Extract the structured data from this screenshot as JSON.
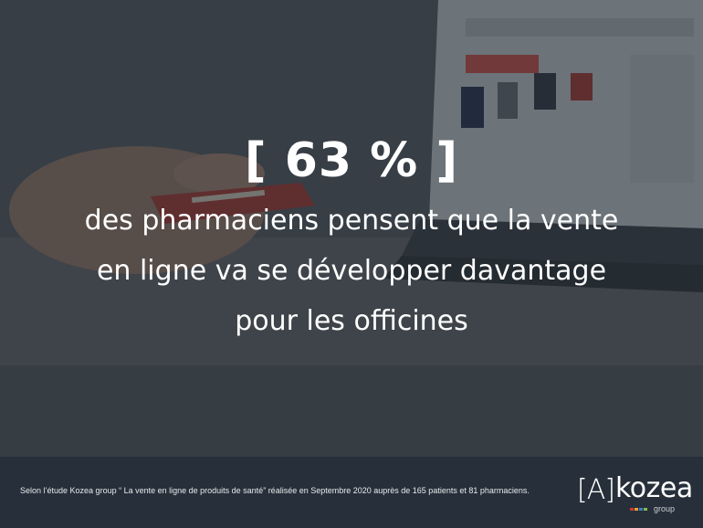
{
  "headline": {
    "stat": "[ 63 % ]",
    "statement": "des pharmaciens pensent que la vente en ligne va se développer davantage pour les officines"
  },
  "footer": {
    "source": "Selon l’étude Kozea group “ La vente en ligne de produits de santé” réalisée en Septembre 2020 auprès de 165 patients et 81 pharmaciens."
  },
  "logo": {
    "mark": "[A]",
    "word": "kozea",
    "sub": "group"
  },
  "colors": {
    "overlay": "#1c242e",
    "footer": "#27303a",
    "dots": [
      "#d13b2f",
      "#e9a23b",
      "#3f7ec6",
      "#8bb84a",
      "#9b5bb0"
    ]
  },
  "background_photo": "laptop-shopping-hand-credit-card"
}
